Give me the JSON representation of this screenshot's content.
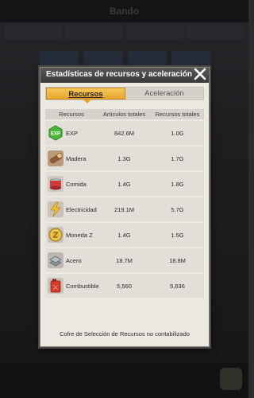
{
  "background": {
    "topbar_title": "Bando"
  },
  "dialog": {
    "title": "Estadísticas de recursos y aceleración",
    "tabs": [
      {
        "label": "Recursos",
        "active": true
      },
      {
        "label": "Aceleración",
        "active": false
      }
    ],
    "columns": [
      "Recursos",
      "Artículos totales",
      "Recursos totales"
    ],
    "rows": [
      {
        "icon": "exp-icon",
        "name": "EXP",
        "items_total": "842.6M",
        "resources_total": "1.0G"
      },
      {
        "icon": "wood-icon",
        "name": "Madera",
        "items_total": "1.3G",
        "resources_total": "1.7G"
      },
      {
        "icon": "food-icon",
        "name": "Comida",
        "items_total": "1.4G",
        "resources_total": "1.8G"
      },
      {
        "icon": "electricity-icon",
        "name": "Electricidad",
        "items_total": "219.1M",
        "resources_total": "5.7G"
      },
      {
        "icon": "z-coin-icon",
        "name": "Moneda Z",
        "items_total": "1.4G",
        "resources_total": "1.5G"
      },
      {
        "icon": "steel-icon",
        "name": "Acero",
        "items_total": "18.7M",
        "resources_total": "18.8M"
      },
      {
        "icon": "fuel-icon",
        "name": "Combustible",
        "items_total": "5,560",
        "resources_total": "5,636"
      }
    ],
    "footer_note": "Cofre de Selección de Recursos no contabilizado"
  },
  "colors": {
    "active_tab": "#e8a52c",
    "dialog_bg": "#ece8e2",
    "header_bg": "#3b3937"
  }
}
